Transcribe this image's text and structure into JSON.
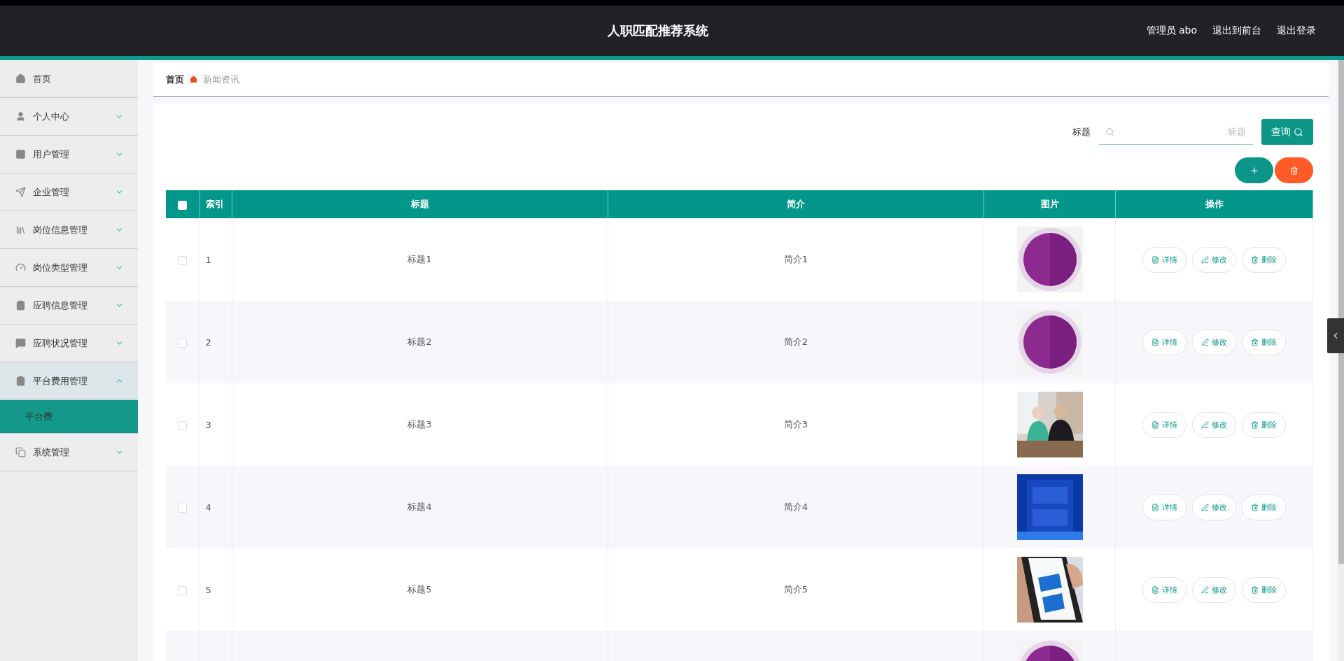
{
  "header": {
    "title": "人职匹配推荐系统",
    "links": [
      "管理员 abo",
      "退出到前台",
      "退出登录"
    ]
  },
  "sidebar": {
    "items": [
      {
        "label": "首页"
      },
      {
        "label": "个人中心",
        "expanded": false
      },
      {
        "label": "用户管理",
        "expanded": false
      },
      {
        "label": "企业管理",
        "expanded": false
      },
      {
        "label": "岗位信息管理",
        "expanded": false
      },
      {
        "label": "岗位类型管理",
        "expanded": false
      },
      {
        "label": "应聘信息管理",
        "expanded": false
      },
      {
        "label": "应聘状况管理",
        "expanded": false
      },
      {
        "label": "平台费用管理",
        "expanded": true,
        "children": [
          {
            "label": "平台费",
            "selected": true
          }
        ]
      },
      {
        "label": "系统管理",
        "expanded": false
      }
    ]
  },
  "breadcrumb": [
    "首页",
    "新闻资讯"
  ],
  "search": {
    "label": "标题",
    "placeholder": "标题",
    "button": "查询"
  },
  "table": {
    "select_all": {
      "checked": false
    },
    "columns": [
      "索引",
      "标题",
      "简介",
      "图片",
      "操作"
    ],
    "rows": [
      {
        "checked": false,
        "index": "1",
        "title": "标题1",
        "intro": "简介1",
        "picture": {
          "kind": "picture"
        },
        "actions": [
          "详情",
          "修改",
          "删除"
        ]
      },
      {
        "checked": false,
        "index": "2",
        "title": "标题2",
        "intro": "简介2",
        "picture": {
          "kind": "picture"
        },
        "actions": [
          "详情",
          "修改",
          "删除"
        ]
      },
      {
        "checked": false,
        "index": "3",
        "title": "标题3",
        "intro": "简介3",
        "picture": {
          "kind": "picture"
        },
        "actions": [
          "详情",
          "修改",
          "删除"
        ]
      },
      {
        "checked": false,
        "index": "4",
        "title": "标题4",
        "intro": "简介4",
        "picture": {
          "kind": "picture"
        },
        "actions": [
          "详情",
          "修改",
          "删除"
        ]
      },
      {
        "checked": false,
        "index": "5",
        "title": "标题5",
        "intro": "简介5",
        "picture": {
          "kind": "picture"
        },
        "actions": [
          "详情",
          "修改",
          "删除"
        ]
      },
      {
        "picture": {
          "kind": "picture"
        }
      }
    ]
  }
}
